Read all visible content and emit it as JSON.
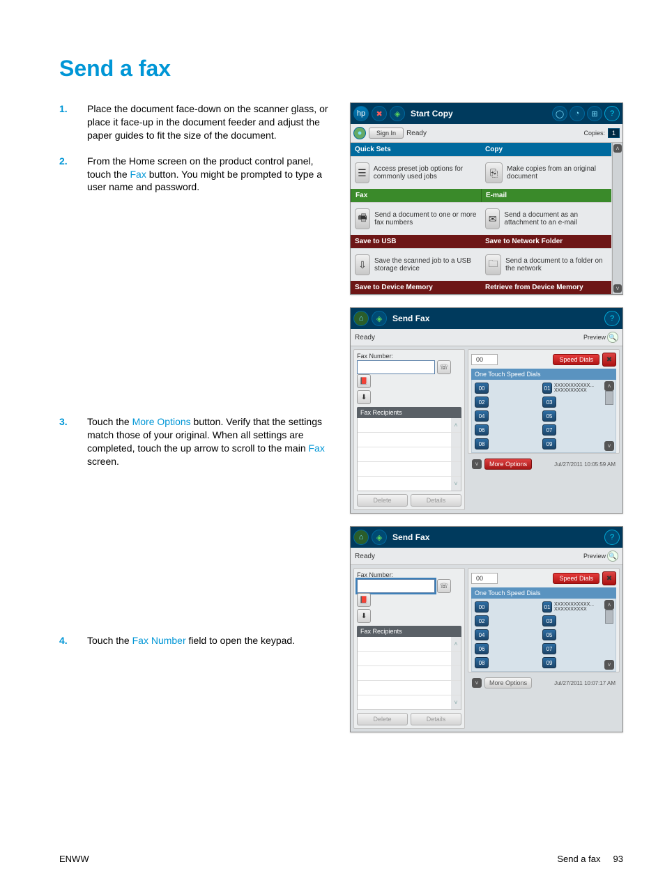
{
  "title": "Send a fax",
  "steps": {
    "s1": "Place the document face-down on the scanner glass, or place it face-up in the document feeder and adjust the paper guides to fit the size of the document.",
    "s2a": "From the Home screen on the product control panel, touch the ",
    "s2k": "Fax",
    "s2b": " button. You might be prompted to type a user name and password.",
    "s3a": "Touch the ",
    "s3k": "More Options",
    "s3b": " button. Verify that the settings match those of your original. When all settings are completed, touch the up arrow to scroll to the main ",
    "s3k2": "Fax",
    "s3c": " screen.",
    "s4a": "Touch the ",
    "s4k": "Fax Number",
    "s4b": " field to open the keypad."
  },
  "home": {
    "start_copy": "Start Copy",
    "sign_in": "Sign In",
    "ready": "Ready",
    "copies_label": "Copies:",
    "copies_value": "1",
    "tiles": {
      "quicksets": {
        "head": "Quick Sets",
        "body": "Access preset job options for commonly used jobs"
      },
      "copy": {
        "head": "Copy",
        "body": "Make copies from an original document"
      },
      "fax": {
        "head": "Fax",
        "body": "Send a document to one or more fax numbers"
      },
      "email": {
        "head": "E-mail",
        "body": "Send a document as an attachment to an e-mail"
      },
      "saveusb": {
        "head": "Save to USB",
        "body": "Save the scanned job to a USB storage device"
      },
      "savenet": {
        "head": "Save to Network Folder",
        "body": "Send a document to a folder on the network"
      },
      "savedm": {
        "head": "Save to Device Memory"
      },
      "retrieve": {
        "head": "Retrieve from Device Memory"
      }
    }
  },
  "fax1": {
    "title": "Send Fax",
    "ready": "Ready",
    "preview": "Preview",
    "fax_number_label": "Fax Number:",
    "fax_number_value": "",
    "fax_recipients": "Fax Recipients",
    "delete": "Delete",
    "details": "Details",
    "speed_list_value": "00",
    "speed_dials_btn": "Speed Dials",
    "one_touch": "One Touch Speed Dials",
    "entries_left": [
      "00",
      "02",
      "04",
      "06",
      "08"
    ],
    "entries_right": [
      "01",
      "03",
      "05",
      "07",
      "09"
    ],
    "entry01_text": "XXXXXXXXXXX... XXXXXXXXXX",
    "more_options": "More Options",
    "timestamp": "Jul/27/2011 10:05:59 AM"
  },
  "fax2": {
    "title": "Send Fax",
    "ready": "Ready",
    "preview": "Preview",
    "fax_number_label": "Fax Number:",
    "fax_number_value": "",
    "fax_recipients": "Fax Recipients",
    "delete": "Delete",
    "details": "Details",
    "speed_list_value": "00",
    "speed_dials_btn": "Speed Dials",
    "one_touch": "One Touch Speed Dials",
    "entries_left": [
      "00",
      "02",
      "04",
      "06",
      "08"
    ],
    "entries_right": [
      "01",
      "03",
      "05",
      "07",
      "09"
    ],
    "entry01_text": "XXXXXXXXXXX... XXXXXXXXXX",
    "more_options": "More Options",
    "timestamp": "Jul/27/2011 10:07:17 AM"
  },
  "footer": {
    "left": "ENWW",
    "right_label": "Send a fax",
    "right_page": "93"
  }
}
